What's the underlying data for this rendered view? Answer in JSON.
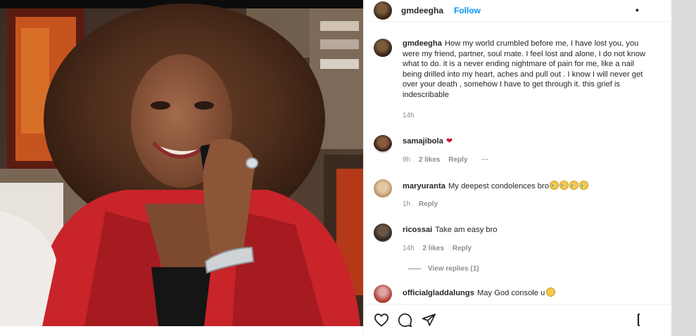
{
  "post": {
    "author": "gmdeegha",
    "follow_label": "Follow",
    "separator": "•",
    "more_label": "•",
    "caption": "How my world crumbled before me, I have lost you, you were my friend, partner, soul mate. I feel lost and alone, I do not know what to do. it is a never ending nightmare of pain for me, like a nail being drilled into my heart, aches and pull out . I know I will never get over your death , somehow I have to get through it. this grief is indescribable",
    "caption_time": "14h"
  },
  "comments": [
    {
      "user": "samajibola",
      "text": "",
      "emoji": "heart",
      "time": "9h",
      "likes": "2 likes",
      "reply": "Reply",
      "more": "···"
    },
    {
      "user": "maryuranta",
      "text": "My deepest condolences bro",
      "emoji": "crying-x4",
      "time": "1h",
      "likes": "",
      "reply": "Reply"
    },
    {
      "user": "ricossai",
      "text": "Take am easy bro",
      "time": "14h",
      "likes": "2 likes",
      "reply": "Reply",
      "view_replies": "View replies (1)"
    },
    {
      "user": "officialgladdalungs",
      "text": "May God console u",
      "emoji": "smile"
    }
  ],
  "icons": {
    "like": "heart-outline-icon",
    "comment": "comment-bubble-icon",
    "share": "paper-plane-icon",
    "save": "bookmark-icon"
  },
  "colors": {
    "link": "#0095f6",
    "muted": "#8e8e8e",
    "text": "#262626",
    "heart": "#c8102e"
  }
}
